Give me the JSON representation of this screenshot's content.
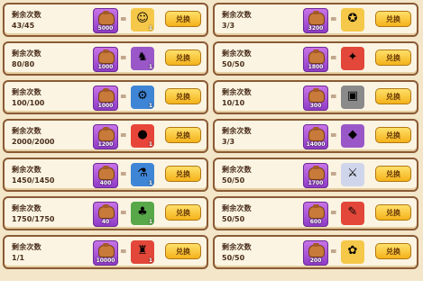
{
  "labels": {
    "remaining": "剩余次数",
    "exchange": "兑换"
  },
  "left": [
    {
      "remain": "43/45",
      "cost": "5000",
      "reward_icon": "smiley-pet-icon",
      "reward_glyph": "☺",
      "reward_bg": "#f5c84a",
      "reward_count": "1"
    },
    {
      "remain": "80/80",
      "cost": "1000",
      "reward_icon": "bunny-pet-icon",
      "reward_glyph": "♞",
      "reward_bg": "#9a57c8",
      "reward_count": "1"
    },
    {
      "remain": "100/100",
      "cost": "1000",
      "reward_icon": "robot-pet-icon",
      "reward_glyph": "⚙",
      "reward_bg": "#3f85d6",
      "reward_count": "1"
    },
    {
      "remain": "2000/2000",
      "cost": "1200",
      "reward_icon": "red-orb-icon",
      "reward_glyph": "●",
      "reward_bg": "#e8453a",
      "reward_count": "1"
    },
    {
      "remain": "1450/1450",
      "cost": "400",
      "reward_icon": "potion-icon",
      "reward_glyph": "⚗",
      "reward_bg": "#3f85d6",
      "reward_count": "1"
    },
    {
      "remain": "1750/1750",
      "cost": "40",
      "reward_icon": "green-pet-icon",
      "reward_glyph": "♣",
      "reward_bg": "#58a84a",
      "reward_count": "1"
    },
    {
      "remain": "1/1",
      "cost": "10000",
      "reward_icon": "treasure-icon",
      "reward_glyph": "♜",
      "reward_bg": "#e2473a",
      "reward_count": "1"
    }
  ],
  "right": [
    {
      "remain": "3/3",
      "cost": "3200",
      "reward_icon": "gold-badge-icon",
      "reward_glyph": "✪",
      "reward_bg": "#f5c84a",
      "reward_count": ""
    },
    {
      "remain": "50/50",
      "cost": "1800",
      "reward_icon": "fire-hammer-icon",
      "reward_glyph": "✦",
      "reward_bg": "#e2473a",
      "reward_count": ""
    },
    {
      "remain": "10/10",
      "cost": "300",
      "reward_icon": "chest-icon",
      "reward_glyph": "▣",
      "reward_bg": "#8a8a8a",
      "reward_count": ""
    },
    {
      "remain": "3/3",
      "cost": "14000",
      "reward_icon": "gem-box-icon",
      "reward_glyph": "◆",
      "reward_bg": "#9a57c8",
      "reward_count": ""
    },
    {
      "remain": "50/50",
      "cost": "1700",
      "reward_icon": "sword-icon",
      "reward_glyph": "⚔",
      "reward_bg": "#cfd5ea",
      "reward_count": ""
    },
    {
      "remain": "50/50",
      "cost": "600",
      "reward_icon": "red-scroll-icon",
      "reward_glyph": "✎",
      "reward_bg": "#e2473a",
      "reward_count": ""
    },
    {
      "remain": "50/50",
      "cost": "200",
      "reward_icon": "fox-pet-icon",
      "reward_glyph": "✿",
      "reward_bg": "#f5c84a",
      "reward_count": ""
    }
  ]
}
